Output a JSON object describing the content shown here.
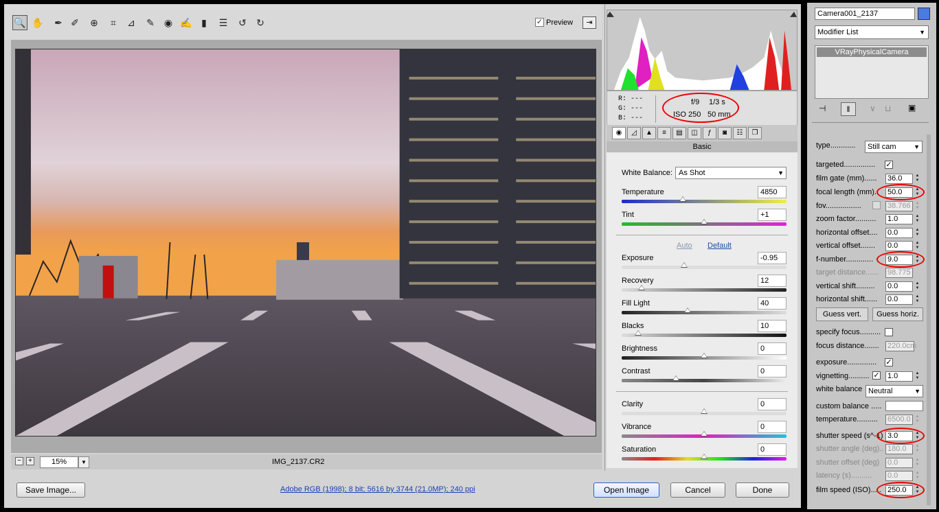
{
  "acr": {
    "toolbar": {
      "tools": [
        "zoom-icon",
        "hand-icon",
        "white-balance-icon",
        "color-sampler-icon",
        "target-adjust-icon",
        "crop-icon",
        "straighten-icon",
        "spot-removal-icon",
        "red-eye-icon",
        "adjustment-brush-icon",
        "graduated-filter-icon",
        "preferences-icon",
        "rotate-ccw-icon",
        "rotate-cw-icon"
      ],
      "preview_label": "Preview",
      "preview_checked": "✓"
    },
    "zoom": {
      "minus": "−",
      "plus": "+",
      "value": "15%"
    },
    "filename": "IMG_2137.CR2",
    "info": {
      "r": "R:  ---",
      "g": "G:  ---",
      "b": "B:  ---",
      "aperture": "f/9",
      "shutter": "1/3 s",
      "iso": "ISO 250",
      "focal": "50 mm"
    },
    "panel_title": "Basic",
    "basic": {
      "wb_label": "White Balance:",
      "wb_value": "As Shot",
      "auto": "Auto",
      "default": "Default",
      "sliders": [
        {
          "label": "Temperature",
          "value": "4850",
          "pos": 0.37
        },
        {
          "label": "Tint",
          "value": "+1",
          "pos": 0.5
        },
        {
          "label": "Exposure",
          "value": "-0.95",
          "pos": 0.38
        },
        {
          "label": "Recovery",
          "value": "12",
          "pos": 0.12
        },
        {
          "label": "Fill Light",
          "value": "40",
          "pos": 0.4
        },
        {
          "label": "Blacks",
          "value": "10",
          "pos": 0.1
        },
        {
          "label": "Brightness",
          "value": "0",
          "pos": 0.5
        },
        {
          "label": "Contrast",
          "value": "0",
          "pos": 0.33
        },
        {
          "label": "Clarity",
          "value": "0",
          "pos": 0.5
        },
        {
          "label": "Vibrance",
          "value": "0",
          "pos": 0.5
        },
        {
          "label": "Saturation",
          "value": "0",
          "pos": 0.5
        }
      ]
    },
    "buttons": {
      "save": "Save Image...",
      "open": "Open Image",
      "cancel": "Cancel",
      "done": "Done"
    },
    "workflow_link": "Adobe RGB (1998); 8 bit; 5616 by 3744 (21.0MP); 240 ppi"
  },
  "max": {
    "object_name": "Camera001_2137",
    "modifier_list": "Modifier List",
    "stack_item": "VRayPhysicalCamera",
    "rows": {
      "type_label": "type............",
      "type_value": "Still cam",
      "targeted": "targeted...............",
      "film_gate": "film gate (mm)......",
      "film_gate_v": "36.0",
      "focal_length": "focal length (mm)..",
      "focal_length_v": "50.0",
      "fov": "fov.................",
      "fov_v": "38.766",
      "zoom_factor": "zoom factor..........",
      "zoom_factor_v": "1.0",
      "h_offset": "horizontal offset....",
      "h_offset_v": "0.0",
      "v_offset": "vertical offset.......",
      "v_offset_v": "0.0",
      "f_number": "f-number.............",
      "f_number_v": "9.0",
      "target_distance": "target distance......",
      "target_distance_v": "98.775",
      "v_shift": "vertical shift.........",
      "v_shift_v": "0.0",
      "h_shift": "horizontal shift......",
      "h_shift_v": "0.0",
      "guess_vert": "Guess vert.",
      "guess_horiz": "Guess horiz.",
      "specify_focus": "specify focus..........",
      "focus_distance": "focus distance.......",
      "focus_distance_v": "220.0cm",
      "exposure": "exposure..............",
      "vignetting": "vignetting..........",
      "vignetting_v": "1.0",
      "white_balance": "white balance",
      "white_balance_v": "Neutral",
      "custom_balance": "custom balance .....",
      "temperature": "temperature..........",
      "temperature_v": "6500.0",
      "shutter_speed": "shutter speed (s^-1)",
      "shutter_speed_v": "3.0",
      "shutter_angle": "shutter angle (deg)..",
      "shutter_angle_v": "180.0",
      "shutter_offset": "shutter offset (deg)",
      "shutter_offset_v": "0.0",
      "latency": "latency (s)..........",
      "latency_v": "0.0",
      "film_speed": "film speed (ISO).....",
      "film_speed_v": "250.0"
    }
  },
  "colors": {
    "accent": "#2a62c4",
    "annotation": "#e00000"
  }
}
